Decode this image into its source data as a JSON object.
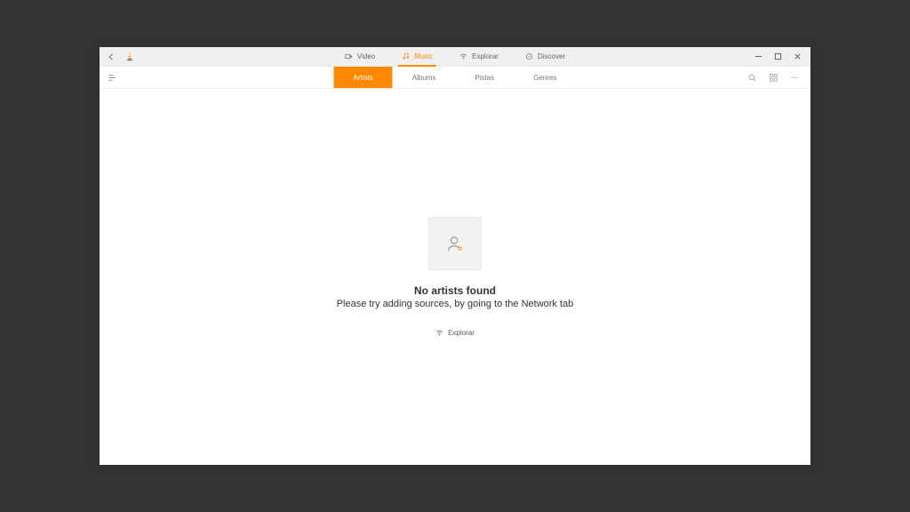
{
  "titlebar": {
    "nav": {
      "video": "Video",
      "music": "Music",
      "explorar": "Explorar",
      "discover": "Discover"
    }
  },
  "subnav": {
    "tabs": {
      "artists": "Artists",
      "albums": "Albums",
      "pistas": "Pistas",
      "genres": "Genres"
    }
  },
  "empty": {
    "title": "No artists found",
    "subtitle": "Please try adding sources, by going to the Network tab",
    "button": "Explorar"
  }
}
